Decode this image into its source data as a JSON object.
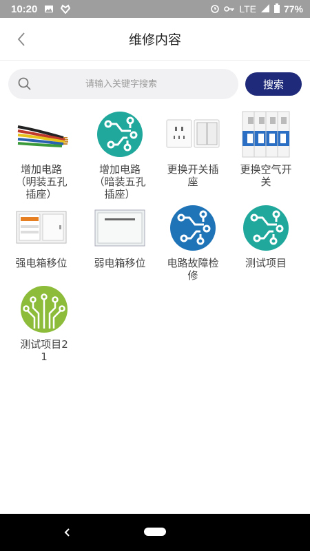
{
  "status_bar": {
    "time": "10:20",
    "network": "LTE",
    "battery": "77%"
  },
  "header": {
    "title": "维修内容"
  },
  "search": {
    "placeholder": "请输入关键字搜索",
    "button_label": "搜索"
  },
  "items": [
    {
      "label": "增加电路（明装五孔插座）",
      "icon": "wires-image"
    },
    {
      "label": "增加电路（暗装五孔插座）",
      "icon": "circuit-teal-icon"
    },
    {
      "label": "更换开关插座",
      "icon": "socket-switch-image"
    },
    {
      "label": "更换空气开关",
      "icon": "circuit-breaker-image"
    },
    {
      "label": "强电箱移位",
      "icon": "power-box-image"
    },
    {
      "label": "弱电箱移位",
      "icon": "weak-box-image"
    },
    {
      "label": "电路故障检修",
      "icon": "circuit-blue-icon"
    },
    {
      "label": "测试项目",
      "icon": "circuit-teal-icon"
    },
    {
      "label": "测试项目21",
      "icon": "circuit-green-icon"
    }
  ],
  "colors": {
    "primary_button": "#1f2a7a",
    "teal": "#20a89c",
    "blue": "#1f74b8",
    "green": "#8cbc3a"
  }
}
